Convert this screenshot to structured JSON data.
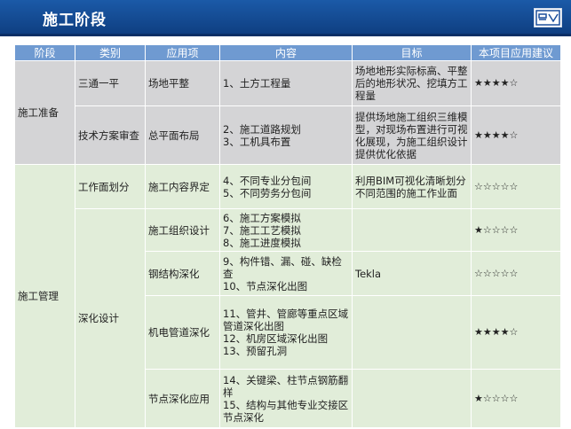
{
  "header": {
    "title": "施工阶段"
  },
  "table": {
    "headers": [
      "阶段",
      "类别",
      "应用项",
      "内容",
      "目标",
      "本项目应用建议"
    ],
    "rows": [
      {
        "stage": "施工准备",
        "category": "三通一平",
        "item": "场地平整",
        "content": [
          "1、土方工程量"
        ],
        "goal": "场地地形实际标高、平整后的地形状况、挖填方工程量",
        "rating": "★★★★☆"
      },
      {
        "category": "技术方案审查",
        "item": "总平面布局",
        "content": [
          "2、施工道路规划",
          "3、工机具布置"
        ],
        "goal": "提供场地施工组织三维模型，对现场布置进行可视化展现，为施工组织设计提供优化依据",
        "rating": "★★★★☆"
      },
      {
        "stage": "施工管理",
        "category": "工作面划分",
        "item": "施工内容界定",
        "content": [
          "4、不同专业分包间",
          "5、不同劳务分包间"
        ],
        "goal": "利用BIM可视化清晰划分不同范围的施工作业面",
        "rating": "☆☆☆☆☆"
      },
      {
        "category": "深化设计",
        "item": "施工组织设计",
        "content": [
          "6、施工方案模拟",
          "7、施工工艺模拟",
          "8、施工进度模拟"
        ],
        "goal": "",
        "rating": "★☆☆☆☆"
      },
      {
        "item": "钢结构深化",
        "content": [
          "9、构件错、漏、碰、缺检查",
          "10、节点深化出图"
        ],
        "goal": "Tekla",
        "rating": "☆☆☆☆☆"
      },
      {
        "item": "机电管道深化",
        "content": [
          "11、管井、管廊等重点区域管道深化出图",
          "12、机房区域深化出图",
          "13、预留孔洞"
        ],
        "goal": "",
        "rating": "★★★★☆"
      },
      {
        "item": "节点深化应用",
        "content": [
          "14、关键梁、柱节点钢筋翻样",
          "15、结构与其他专业交接区节点深化"
        ],
        "goal": "",
        "rating": "★☆☆☆☆"
      }
    ]
  }
}
